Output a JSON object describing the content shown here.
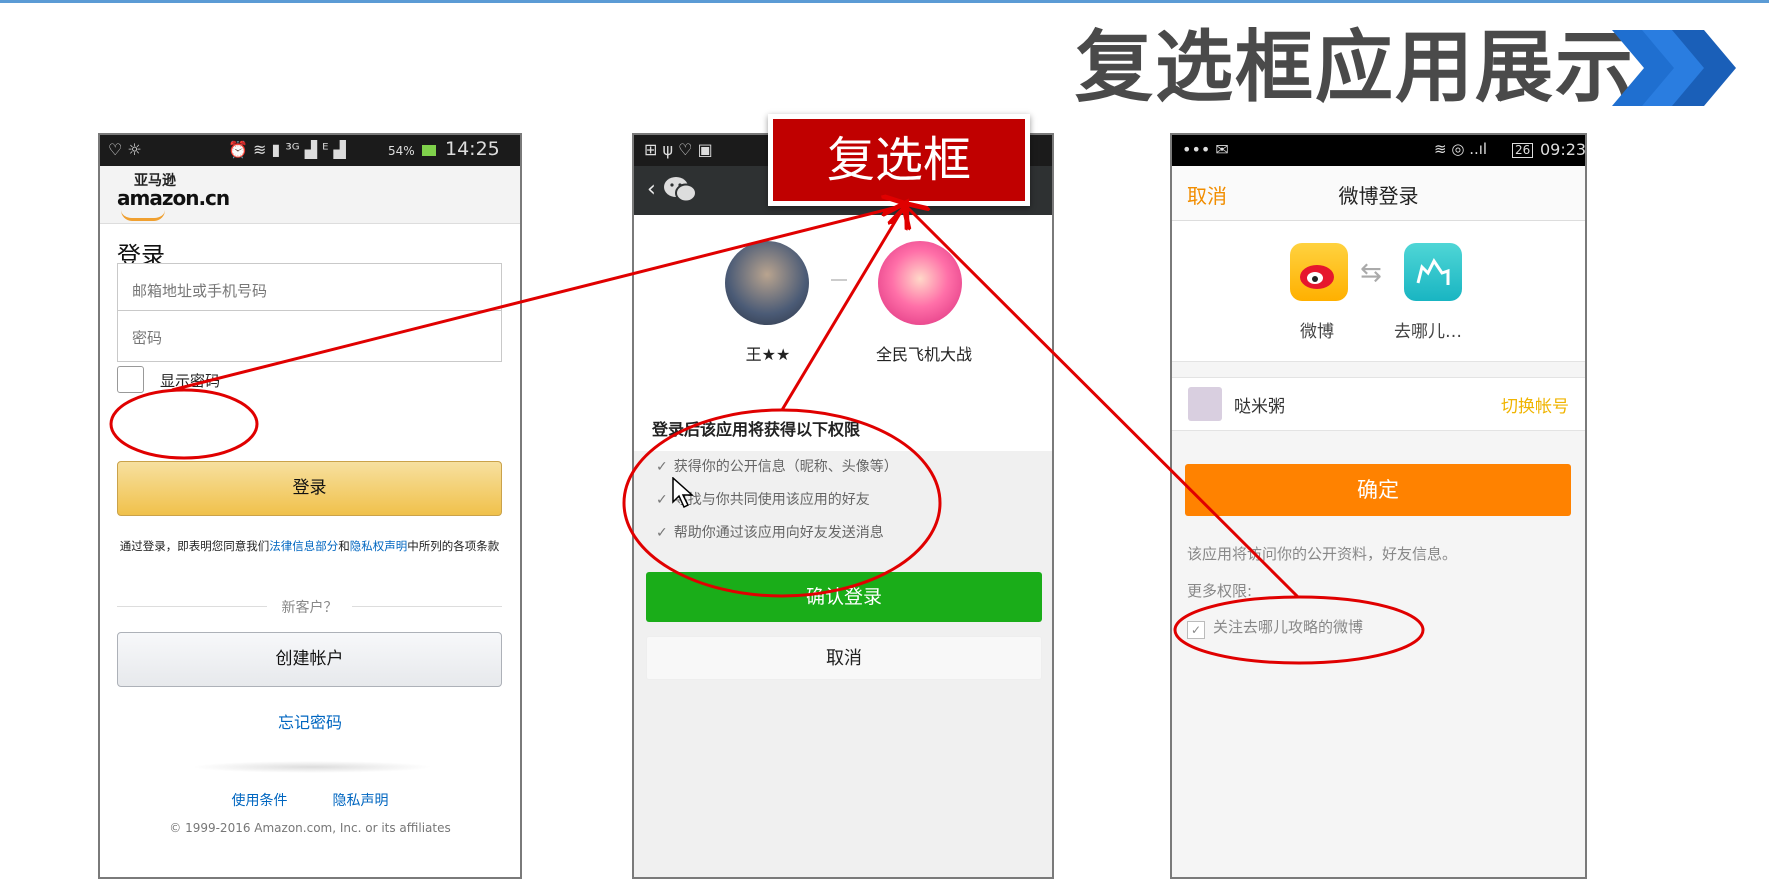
{
  "slide": {
    "title": "复选框应用展示"
  },
  "callout": {
    "label": "复选框"
  },
  "colors": {
    "annotation_red": "#e00000",
    "callout_red": "#c00000",
    "wechat_green": "#1aad19",
    "weibo_orange": "#ff8200",
    "amazon_yellow": "#f0c14b",
    "link_blue": "#0066c0",
    "title_blue_chevron": "#1f6fd0"
  },
  "amazon": {
    "status_time": "14:25",
    "status_battery": "54%",
    "logo_cn": "亚马逊",
    "logo_text": "amazon.cn",
    "title": "登录",
    "email_placeholder": "邮箱地址或手机号码",
    "password_placeholder": "密码",
    "show_password_label": "显示密码",
    "login_button": "登录",
    "terms_prefix": "通过登录，即表明您同意我们",
    "terms_link1": "法律信息部分",
    "terms_and": "和",
    "terms_link2": "隐私权声明",
    "terms_suffix": "中所列的各项条款",
    "new_customer": "新客户？",
    "create_account_button": "创建帐户",
    "forgot_password": "忘记密码",
    "footer_terms": "使用条件",
    "footer_privacy": "隐私声明",
    "copyright": "© 1999-2016 Amazon.com, Inc. or its affiliates"
  },
  "wechat": {
    "user_name": "王★★",
    "app_name": "全民飞机大战",
    "permissions_title": "登录后该应用将获得以下权限",
    "permissions": [
      "获得你的公开信息（昵称、头像等）",
      "寻找与你共同使用该应用的好友",
      "帮助你通过该应用向好友发送消息"
    ],
    "confirm_button": "确认登录",
    "cancel_button": "取消",
    "back_icon": "chevron-left-icon",
    "logo_icon": "wechat-icon"
  },
  "weibo": {
    "status_time": "09:23",
    "status_battery": "26",
    "cancel": "取消",
    "title": "微博登录",
    "app1_name": "微博",
    "app2_name": "去哪儿…",
    "user_name": "哒米粥",
    "switch_account": "切换帐号",
    "confirm_button": "确定",
    "access_note": "该应用将访问你的公开资料，好友信息。",
    "more_permissions": "更多权限:",
    "follow_option": "关注去哪儿攻略的微博"
  }
}
